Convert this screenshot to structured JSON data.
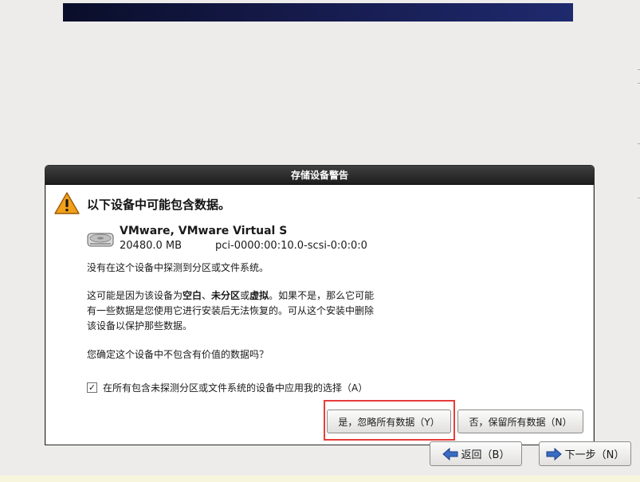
{
  "dialog": {
    "title": "存储设备警告",
    "heading": "以下设备中可能包含数据。",
    "device": {
      "name": "VMware, VMware Virtual S",
      "size": "20480.0 MB",
      "path": "pci-0000:00:10.0-scsi-0:0:0:0"
    },
    "para1": "没有在这个设备中探测到分区或文件系统。",
    "para2": {
      "line1_a": "这可能是因为该设备为",
      "blank": "空白",
      "sep1": "、",
      "unpartitioned": "未分区",
      "sep2": "或",
      "virtual": "虚拟",
      "line1_b": "。如果不是，那么它可能",
      "line2": "有一些数据是您使用它进行安装后无法恢复的。可从这个安装中删除",
      "line3": "该设备以保护那些数据。"
    },
    "para3": "您确定这个设备中不包含有价值的数据吗？",
    "apply_all_label": "在所有包含未探测分区或文件系统的设备中应用我的选择（A）",
    "apply_all_checked": true,
    "check_mark": "✓",
    "yes_label": "是，忽略所有数据（Y）",
    "no_label": "否，保留所有数据（N）"
  },
  "nav": {
    "back_label": "返回（B）",
    "next_label": "下一步（N）"
  },
  "colors": {
    "highlight": "#e63c3c",
    "warning": "#f2a01a",
    "banner": "#151a4a"
  },
  "icons": {
    "warning": "warning-icon",
    "disk": "hard-disk-icon",
    "back": "arrow-left-icon",
    "next": "arrow-right-icon"
  }
}
